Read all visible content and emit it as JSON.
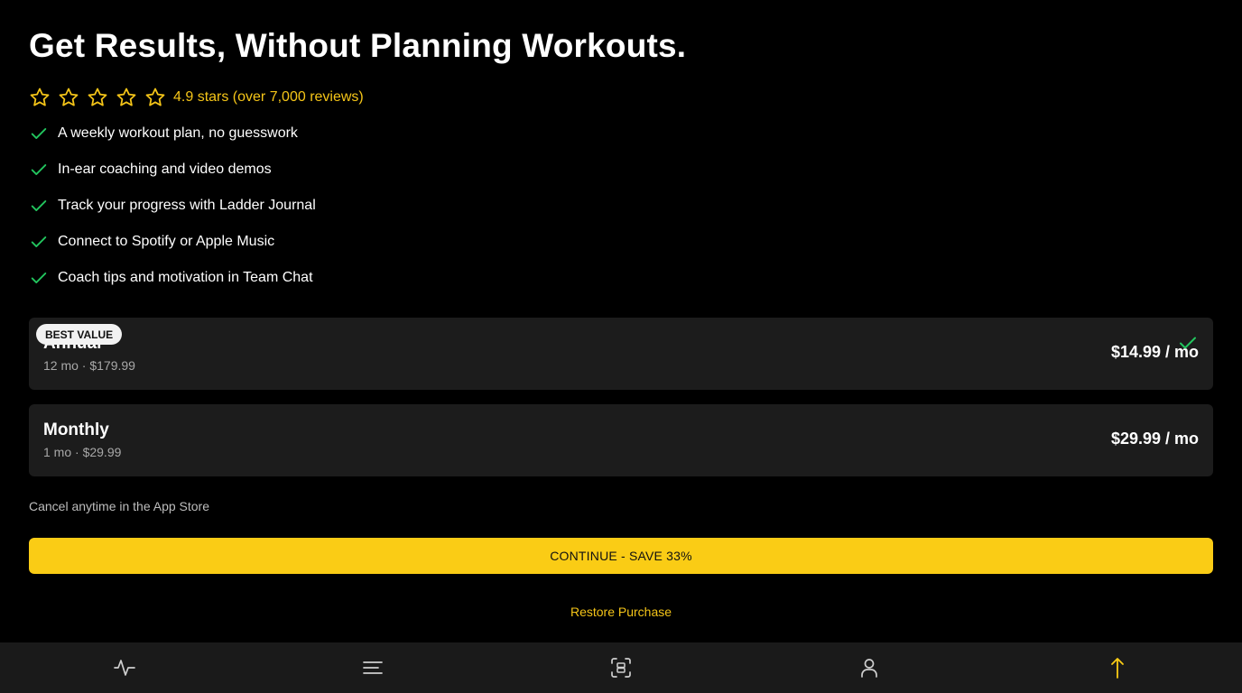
{
  "headline": "Get Results, Without Planning Workouts.",
  "rating": {
    "stars": 5,
    "text": "4.9 stars (over 7,000 reviews)",
    "color": "#f5c518"
  },
  "features": [
    "A weekly workout plan, no guesswork",
    "In-ear coaching and video demos",
    "Track your progress with Ladder Journal",
    "Connect to Spotify or Apple Music",
    "Coach tips and motivation in Team Chat"
  ],
  "plans": {
    "annual": {
      "badge": "BEST VALUE",
      "name": "Annual",
      "sub": "12 mo · $179.99",
      "price": "$14.99 / mo",
      "selected": true
    },
    "monthly": {
      "name": "Monthly",
      "sub": "1 mo · $29.99",
      "price": "$29.99 / mo",
      "selected": false
    }
  },
  "cancel_note": "Cancel anytime in the App Store",
  "cta_label": "CONTINUE - SAVE 33%",
  "restore_label": "Restore Purchase",
  "tabbar": {
    "items": [
      {
        "icon": "activity-icon",
        "active": false
      },
      {
        "icon": "menu-lines-icon",
        "active": false
      },
      {
        "icon": "scan-icon",
        "active": false
      },
      {
        "icon": "user-icon",
        "active": false
      },
      {
        "icon": "arrow-up-icon",
        "active": true
      }
    ]
  },
  "colors": {
    "accent": "#facc15",
    "check_green": "#22c55e",
    "card_bg": "#1c1c1c",
    "background": "#000000"
  }
}
